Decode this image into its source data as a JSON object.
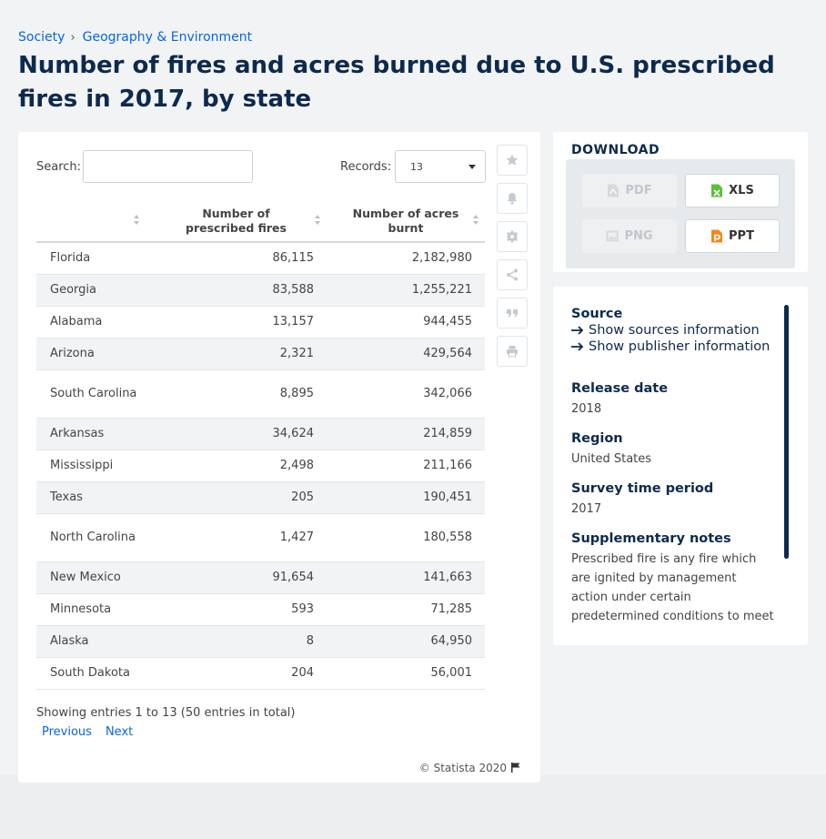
{
  "breadcrumb": {
    "items": [
      "Society",
      "Geography & Environment"
    ],
    "separator": "›"
  },
  "title": "Number of fires and acres burned due to U.S. prescribed fires in 2017, by state",
  "table_controls": {
    "search_label": "Search:",
    "search_value": "",
    "records_label": "Records:",
    "records_value": "13"
  },
  "table": {
    "headers": [
      "",
      "Number of prescribed fires",
      "Number of acres burnt"
    ],
    "rows": [
      [
        "Florida",
        "86,115",
        "2,182,980"
      ],
      [
        "Georgia",
        "83,588",
        "1,255,221"
      ],
      [
        "Alabama",
        "13,157",
        "944,455"
      ],
      [
        "Arizona",
        "2,321",
        "429,564"
      ],
      [
        "South Carolina",
        "8,895",
        "342,066"
      ],
      [
        "Arkansas",
        "34,624",
        "214,859"
      ],
      [
        "Mississippi",
        "2,498",
        "211,166"
      ],
      [
        "Texas",
        "205",
        "190,451"
      ],
      [
        "North Carolina",
        "1,427",
        "180,558"
      ],
      [
        "New Mexico",
        "91,654",
        "141,663"
      ],
      [
        "Minnesota",
        "593",
        "71,285"
      ],
      [
        "Alaska",
        "8",
        "64,950"
      ],
      [
        "South Dakota",
        "204",
        "56,001"
      ]
    ]
  },
  "pagination": {
    "showing": "Showing entries 1 to 13 (50 entries in total)",
    "previous": "Previous",
    "next": "Next"
  },
  "copyright": "© Statista 2020",
  "toolbar": {
    "icons": [
      "star-icon",
      "bell-icon",
      "gear-icon",
      "share-icon",
      "quote-icon",
      "print-icon"
    ]
  },
  "download": {
    "title": "DOWNLOAD",
    "buttons": [
      {
        "label": "PDF",
        "enabled": false
      },
      {
        "label": "XLS",
        "enabled": true
      },
      {
        "label": "PNG",
        "enabled": false
      },
      {
        "label": "PPT",
        "enabled": true
      }
    ]
  },
  "source": {
    "heading": "Source",
    "links": [
      "Show sources information",
      "Show publisher information"
    ],
    "release_date_label": "Release date",
    "release_date": "2018",
    "region_label": "Region",
    "region": "United States",
    "survey_label": "Survey time period",
    "survey": "2017",
    "notes_label": "Supplementary notes",
    "notes": "Prescribed fire is any fire which are ignited by management action under certain predetermined conditions to meet specific"
  },
  "colors": {
    "title": "#0d2a4d",
    "link": "#0666e5",
    "xls_green": "#5bbf3c",
    "ppt_orange": "#f18a1c"
  }
}
